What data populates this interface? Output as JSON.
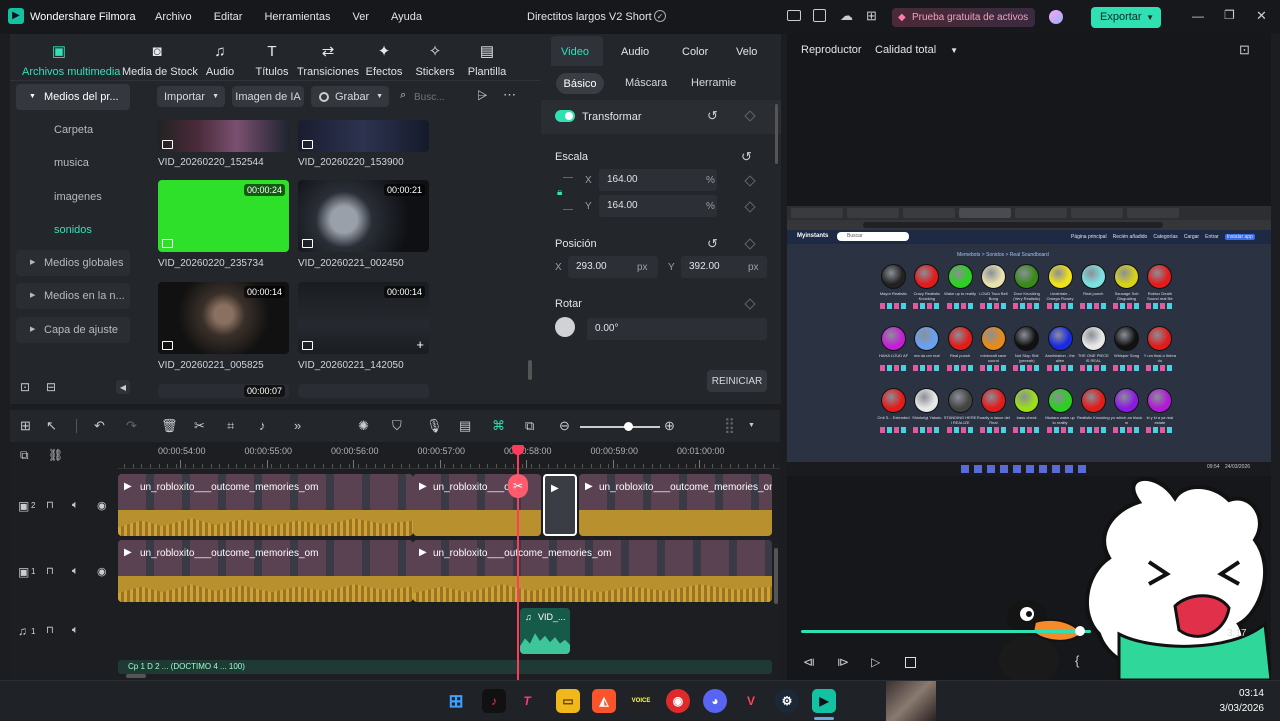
{
  "app": {
    "title": "Wondershare Filmora",
    "project": "Directitos largos V2 Short",
    "trial": "Prueba gratuita de activos",
    "export": "Exportar"
  },
  "menu": [
    "Archivo",
    "Editar",
    "Herramientas",
    "Ver",
    "Ayuda"
  ],
  "media_tabs": [
    "Archivos multimedia",
    "Media de Stock",
    "Audio",
    "Títulos",
    "Transiciones",
    "Efectos",
    "Stickers",
    "Plantilla"
  ],
  "sidebar": {
    "root": "Medios del pr...",
    "items": [
      "Carpeta",
      "musica",
      "imagenes",
      "sonidos"
    ],
    "groups": [
      "Medios globales",
      "Medios en la n...",
      "Capa de ajuste"
    ]
  },
  "toolbar": {
    "import": "Importar",
    "ai_image": "Imagen de IA",
    "record": "Grabar",
    "search_placeholder": "Busc..."
  },
  "media_items": [
    {
      "name": "VID_20260220_152544",
      "duration": ""
    },
    {
      "name": "VID_20260220_153900",
      "duration": ""
    },
    {
      "name": "VID_20260220_235734",
      "duration": "00:00:24"
    },
    {
      "name": "VID_20260221_002450",
      "duration": "00:00:21"
    },
    {
      "name": "VID_20260221_005825",
      "duration": "00:00:14"
    },
    {
      "name": "VID_20260221_142050",
      "duration": "00:00:14"
    },
    {
      "name": "",
      "duration": "00:00:07"
    }
  ],
  "props": {
    "tabs": [
      "Video",
      "Audio",
      "Color",
      "Velo"
    ],
    "subtabs": [
      "Básico",
      "Máscara",
      "Herramie"
    ],
    "transform": "Transformar",
    "scale": {
      "label": "Escala",
      "x_label": "X",
      "x": "164.00",
      "y_label": "Y",
      "y": "164.00",
      "unit": "%"
    },
    "position": {
      "label": "Posición",
      "x_label": "X",
      "x": "293.00",
      "y_label": "Y",
      "y": "392.00",
      "unit": "px"
    },
    "rotate": {
      "label": "Rotar",
      "value": "0.00°"
    },
    "reset": "REINICIAR"
  },
  "preview": {
    "label": "Reproductor",
    "quality": "Calidad total",
    "time": "3:17"
  },
  "timeline": {
    "ticks": [
      "00:00:54:00",
      "00:00:55:00",
      "00:00:56:00",
      "00:00:57:00",
      "00:00:58:00",
      "00:00:59:00",
      "00:01:00:00"
    ],
    "tracks": [
      {
        "label": "2"
      },
      {
        "label": "1"
      },
      {
        "label": "1"
      }
    ],
    "clip_name": "un_robloxito___outcome_memories_om",
    "clip_short": "un_robloxito___outc",
    "clip_short2": "un_robloxito___outcome_memories_om",
    "audio_clip": "VID_...",
    "bottom_clip": "Cp 1 D 2 ... (DOCTIMO 4 ... 100)"
  },
  "screen": {
    "site": "Myinstants",
    "search": "Buscar",
    "nav": [
      "Página principal",
      "Recién añadido",
      "Categorías",
      "Cargar",
      "Entrar",
      "Instalar app"
    ],
    "breadcrumb": "Memebots > Sonidos > Real Soundboard",
    "buttons": [
      {
        "label": "Mayor Realistic",
        "color": "#222222"
      },
      {
        "label": "Crazy Realistic Knocking",
        "color": "#e21b1b"
      },
      {
        "label": "Wake up to reality",
        "color": "#2ad11f"
      },
      {
        "label": "LOUD Taco Bell Bong",
        "color": "#e8e2b0"
      },
      {
        "label": "Door Knocking (Very Realistic)",
        "color": "#3a8a1a"
      },
      {
        "label": "Undertale - Omega Flowey",
        "color": "#f0e21a"
      },
      {
        "label": "Real punch",
        "color": "#7fe0e0"
      },
      {
        "label": "Sausage Sob Disgusting",
        "color": "#d6d21a"
      },
      {
        "label": "Roblox Death Sound real file",
        "color": "#e21b1b"
      },
      {
        "label": "HAHA LOUD AF",
        "color": "#c41fd6"
      },
      {
        "label": "ma da um real",
        "color": "#6aa0f0"
      },
      {
        "label": "Real punch",
        "color": "#e21b1b"
      },
      {
        "label": "minecraft cave sound",
        "color": "#e88a1a"
      },
      {
        "label": "Not Stop Shit (yeeeah)",
        "color": "#111111"
      },
      {
        "label": "Annihilation - the alien",
        "color": "#1a2ae0"
      },
      {
        "label": "THE ONE PIECE IS REAL",
        "color": "#e8e8e8"
      },
      {
        "label": "Whisper Song",
        "color": "#111111"
      },
      {
        "label": "Y um final a ñebra du",
        "color": "#e21b1b"
      },
      {
        "label": "Onii S... Extended",
        "color": "#e21b1b"
      },
      {
        "label": "Shinkeigi Yakuto",
        "color": "#e8e8e8"
      },
      {
        "label": "STANDING HERE I REALIZE",
        "color": "#444444"
      },
      {
        "label": "Roadly a lance del Real",
        "color": "#e21b1b"
      },
      {
        "label": "bass check",
        "color": "#9ae01a"
      },
      {
        "label": "Madara wake up to reality",
        "color": "#2ad11f"
      },
      {
        "label": "Realistic Knocking",
        "color": "#e21b1b"
      },
      {
        "label": "yo which an black m",
        "color": "#8a1ae0"
      },
      {
        "label": "ki y ki a ya real estate",
        "color": "#b01ad6"
      }
    ],
    "taskbar_time": "09:54",
    "taskbar_date": "24/03/2026"
  },
  "taskbar": {
    "time": "03:14",
    "date": "3/03/2026"
  }
}
